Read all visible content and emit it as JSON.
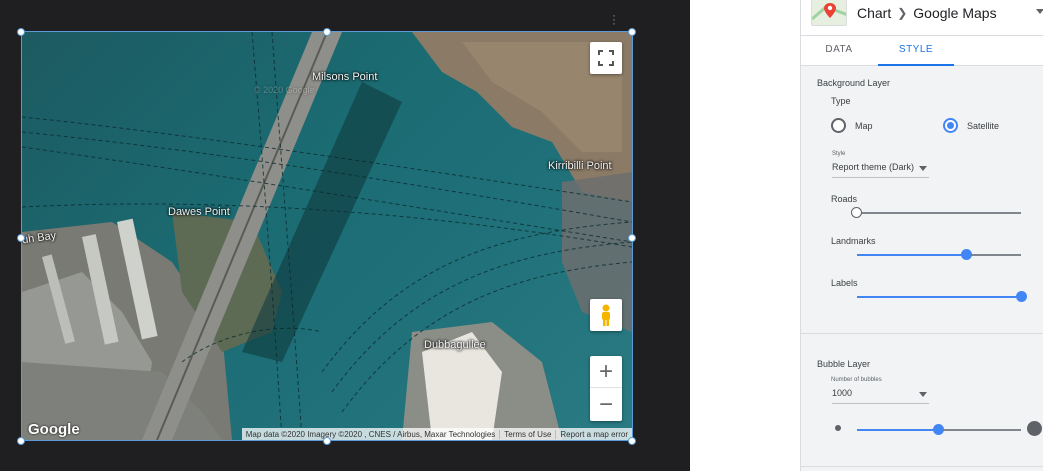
{
  "map": {
    "labels": {
      "milsons_point": "Milsons Point",
      "kirribilli_point": "Kirribilli Point",
      "dawes_point": "Dawes Point",
      "dubbagullee": "Dubbagullee",
      "bay": "uh Bay"
    },
    "watermark": "© 2020 Google",
    "logo": "Google",
    "attribution": {
      "map_data": "Map data ©2020 Imagery ©2020 , CNES / Airbus, Maxar Technologies",
      "terms": "Terms of Use",
      "report": "Report a map error"
    },
    "controls": {
      "fullscreen_icon": "fullscreen-icon",
      "pegman_icon": "pegman-icon",
      "zoom_in": "+",
      "zoom_out": "−"
    }
  },
  "panel": {
    "breadcrumb": {
      "root": "Chart",
      "current": "Google Maps"
    },
    "tabs": {
      "data": "DATA",
      "style": "STYLE"
    },
    "background_layer": {
      "title": "Background Layer",
      "type_label": "Type",
      "options": {
        "map": "Map",
        "satellite": "Satellite"
      },
      "selected": "Satellite",
      "style_label": "Style",
      "style_value": "Report theme (Dark)",
      "sliders": {
        "roads": {
          "label": "Roads",
          "value": 0.0
        },
        "landmarks": {
          "label": "Landmarks",
          "value": 0.66
        },
        "labels": {
          "label": "Labels",
          "value": 1.0
        }
      }
    },
    "bubble_layer": {
      "title": "Bubble Layer",
      "number_label": "Number of bubbles",
      "number_value": "1000",
      "size_slider": 0.46
    }
  },
  "colors": {
    "accent": "#4285f4",
    "selection": "#5b9bd5",
    "water": "#1b6b72"
  }
}
